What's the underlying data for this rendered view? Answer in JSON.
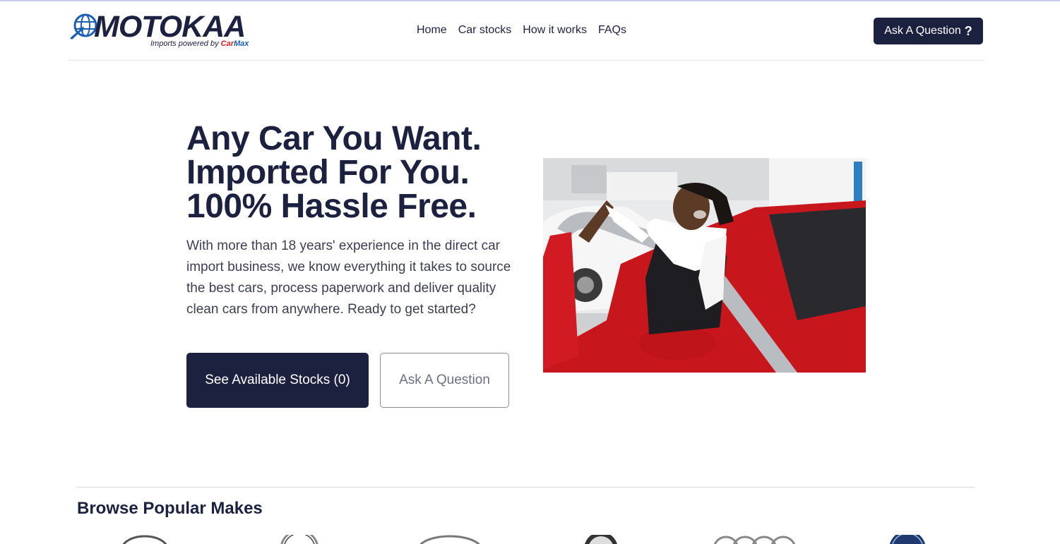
{
  "brand": {
    "name": "MOTOKAA",
    "tagline_prefix": "Imports powered by",
    "partner_a": "Car",
    "partner_b": "Max",
    "logo_icon": "globe-icon",
    "color_primary": "#1c2140",
    "color_partner_a": "#d42027",
    "color_partner_b": "#1b5fb5"
  },
  "nav": {
    "items": [
      {
        "label": "Home"
      },
      {
        "label": "Car stocks"
      },
      {
        "label": "How it works"
      },
      {
        "label": "FAQs"
      }
    ]
  },
  "header": {
    "ask_label": "Ask A Question",
    "ask_icon": "question-mark-icon",
    "ask_icon_glyph": "?"
  },
  "hero": {
    "title_lines": [
      "Any Car You Want.",
      "Imported For You.",
      "100% Hassle Free."
    ],
    "description": "With more than 18 years' experience in the direct car import business, we know everything it takes to source the best cars, process paperwork and deliver quality clean cars from anywhere. Ready to get started?",
    "primary_button": "See Available Stocks (0)",
    "secondary_button": "Ask A Question"
  },
  "browse": {
    "title": "Browse Popular Makes",
    "makes": [
      {
        "icon": "make-logo-1-icon"
      },
      {
        "icon": "make-logo-2-icon"
      },
      {
        "icon": "make-logo-3-icon"
      },
      {
        "icon": "make-logo-4-icon"
      },
      {
        "icon": "make-logo-5-icon"
      },
      {
        "icon": "make-logo-6-icon"
      }
    ]
  }
}
